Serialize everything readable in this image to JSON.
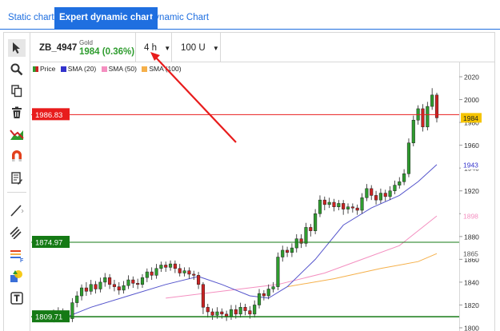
{
  "tabs": [
    {
      "label": "Static chart",
      "active": false
    },
    {
      "label": "Expert dynamic chart",
      "active": true
    },
    {
      "label": "Dynamic Chart",
      "active": false
    }
  ],
  "instrument": {
    "symbol": "ZB_4947",
    "name": "Gold",
    "price_change": "1984 (0.36%)",
    "timeframe": "4 h",
    "units": "100 U"
  },
  "legend": [
    {
      "label": "Price",
      "color": "#2e9c2e"
    },
    {
      "label": "SMA (20)",
      "color": "#3333cc"
    },
    {
      "label": "SMA (50)",
      "color": "#f48fc0"
    },
    {
      "label": "SMA (100)",
      "color": "#f5b04a"
    }
  ],
  "toolbar_icons": [
    "cursor-icon",
    "zoom-icon",
    "copy-icon",
    "trash-icon",
    "chart-type-icon",
    "magnet-icon",
    "notes-icon",
    "line-tool-icon",
    "parallel-lines-icon",
    "fibonacci-icon",
    "shapes-icon",
    "text-tool-icon"
  ],
  "colors": {
    "accent": "#1f6fe0",
    "up": "#2e9c2e",
    "down": "#cc2222",
    "sma20": "#5555cc",
    "sma50": "#f48fc0",
    "sma100": "#f5b04a"
  },
  "levels": [
    {
      "label": "1986.83",
      "value": 1986.83,
      "color": "#e81c1c"
    },
    {
      "label": "1874.97",
      "value": 1874.97,
      "color": "#157a15"
    },
    {
      "label": "1809.71",
      "value": 1809.71,
      "color": "#157a15"
    }
  ],
  "right_badges": [
    {
      "label": "1984",
      "value": 1984,
      "bg": "#f5c400",
      "fg": "#222222"
    },
    {
      "label": "1943",
      "value": 1943,
      "bg": "#ffffff",
      "fg": "#3333cc"
    },
    {
      "label": "1898",
      "value": 1898,
      "bg": "#ffffff",
      "fg": "#f48fc0"
    },
    {
      "label": "1865",
      "value": 1865,
      "bg": "#ffffff",
      "fg": "#555555"
    }
  ],
  "chart_data": {
    "type": "candlestick",
    "ylim": [
      1800,
      2030
    ],
    "y_ticks": [
      1800,
      1820,
      1840,
      1860,
      1880,
      1900,
      1920,
      1940,
      1960,
      1980,
      2000,
      2020
    ],
    "candles": [
      [
        1809,
        1812,
        1806,
        1816
      ],
      [
        1812,
        1814,
        1808,
        1818
      ],
      [
        1814,
        1811,
        1808,
        1817
      ],
      [
        1811,
        1808,
        1805,
        1814
      ],
      [
        1808,
        1822,
        1805,
        1826
      ],
      [
        1822,
        1828,
        1818,
        1832
      ],
      [
        1828,
        1835,
        1824,
        1838
      ],
      [
        1835,
        1832,
        1828,
        1840
      ],
      [
        1832,
        1838,
        1829,
        1842
      ],
      [
        1838,
        1834,
        1830,
        1841
      ],
      [
        1834,
        1840,
        1831,
        1844
      ],
      [
        1840,
        1844,
        1836,
        1848
      ],
      [
        1844,
        1838,
        1834,
        1847
      ],
      [
        1838,
        1836,
        1832,
        1842
      ],
      [
        1836,
        1833,
        1829,
        1840
      ],
      [
        1833,
        1837,
        1830,
        1841
      ],
      [
        1837,
        1842,
        1834,
        1846
      ],
      [
        1842,
        1839,
        1835,
        1845
      ],
      [
        1839,
        1838,
        1834,
        1843
      ],
      [
        1838,
        1844,
        1835,
        1847
      ],
      [
        1844,
        1849,
        1840,
        1852
      ],
      [
        1849,
        1846,
        1842,
        1853
      ],
      [
        1846,
        1852,
        1843,
        1856
      ],
      [
        1852,
        1855,
        1849,
        1858
      ],
      [
        1855,
        1853,
        1849,
        1858
      ],
      [
        1853,
        1856,
        1850,
        1859
      ],
      [
        1856,
        1852,
        1848,
        1859
      ],
      [
        1852,
        1848,
        1845,
        1856
      ],
      [
        1848,
        1850,
        1845,
        1853
      ],
      [
        1850,
        1847,
        1843,
        1853
      ],
      [
        1847,
        1846,
        1842,
        1850
      ],
      [
        1846,
        1838,
        1834,
        1849
      ],
      [
        1838,
        1818,
        1812,
        1840
      ],
      [
        1818,
        1814,
        1809,
        1821
      ],
      [
        1814,
        1811,
        1807,
        1817
      ],
      [
        1811,
        1814,
        1808,
        1818
      ],
      [
        1814,
        1812,
        1808,
        1817
      ],
      [
        1812,
        1810,
        1806,
        1815
      ],
      [
        1810,
        1816,
        1807,
        1820
      ],
      [
        1816,
        1812,
        1808,
        1820
      ],
      [
        1812,
        1818,
        1809,
        1822
      ],
      [
        1818,
        1815,
        1811,
        1821
      ],
      [
        1815,
        1812,
        1808,
        1819
      ],
      [
        1812,
        1820,
        1809,
        1824
      ],
      [
        1820,
        1830,
        1817,
        1834
      ],
      [
        1830,
        1828,
        1824,
        1833
      ],
      [
        1828,
        1834,
        1825,
        1838
      ],
      [
        1834,
        1836,
        1831,
        1840
      ],
      [
        1836,
        1862,
        1833,
        1866
      ],
      [
        1862,
        1868,
        1858,
        1872
      ],
      [
        1868,
        1866,
        1862,
        1871
      ],
      [
        1866,
        1870,
        1862,
        1874
      ],
      [
        1870,
        1878,
        1866,
        1882
      ],
      [
        1878,
        1874,
        1870,
        1882
      ],
      [
        1874,
        1888,
        1871,
        1892
      ],
      [
        1888,
        1885,
        1880,
        1891
      ],
      [
        1885,
        1900,
        1882,
        1904
      ],
      [
        1900,
        1912,
        1897,
        1916
      ],
      [
        1912,
        1908,
        1903,
        1915
      ],
      [
        1908,
        1910,
        1905,
        1914
      ],
      [
        1910,
        1906,
        1902,
        1913
      ],
      [
        1906,
        1909,
        1903,
        1912
      ],
      [
        1909,
        1904,
        1899,
        1912
      ],
      [
        1904,
        1906,
        1900,
        1909
      ],
      [
        1906,
        1905,
        1901,
        1909
      ],
      [
        1905,
        1903,
        1899,
        1908
      ],
      [
        1903,
        1914,
        1900,
        1918
      ],
      [
        1914,
        1922,
        1911,
        1926
      ],
      [
        1922,
        1916,
        1912,
        1925
      ],
      [
        1916,
        1912,
        1908,
        1920
      ],
      [
        1912,
        1918,
        1909,
        1922
      ],
      [
        1918,
        1915,
        1911,
        1921
      ],
      [
        1915,
        1920,
        1912,
        1924
      ],
      [
        1920,
        1925,
        1917,
        1929
      ],
      [
        1925,
        1928,
        1922,
        1932
      ],
      [
        1928,
        1935,
        1925,
        1939
      ],
      [
        1935,
        1962,
        1932,
        1966
      ],
      [
        1962,
        1982,
        1959,
        1986
      ],
      [
        1982,
        1992,
        1978,
        1995
      ],
      [
        1992,
        1976,
        1972,
        1996
      ],
      [
        1976,
        1994,
        1973,
        1998
      ],
      [
        1994,
        2004,
        1991,
        2010
      ],
      [
        2004,
        1984,
        1980,
        2006
      ]
    ],
    "sma20": [
      [
        0,
        1805
      ],
      [
        8,
        1818
      ],
      [
        16,
        1828
      ],
      [
        24,
        1838
      ],
      [
        31,
        1845
      ],
      [
        36,
        1838
      ],
      [
        42,
        1828
      ],
      [
        46,
        1826
      ],
      [
        50,
        1836
      ],
      [
        56,
        1860
      ],
      [
        62,
        1890
      ],
      [
        68,
        1905
      ],
      [
        74,
        1916
      ],
      [
        78,
        1928
      ],
      [
        82,
        1943
      ]
    ],
    "sma50": [
      [
        24,
        1826
      ],
      [
        36,
        1832
      ],
      [
        48,
        1838
      ],
      [
        58,
        1848
      ],
      [
        66,
        1860
      ],
      [
        74,
        1872
      ],
      [
        82,
        1898
      ]
    ],
    "sma100": [
      [
        50,
        1836
      ],
      [
        60,
        1843
      ],
      [
        70,
        1852
      ],
      [
        78,
        1858
      ],
      [
        82,
        1865
      ]
    ]
  }
}
